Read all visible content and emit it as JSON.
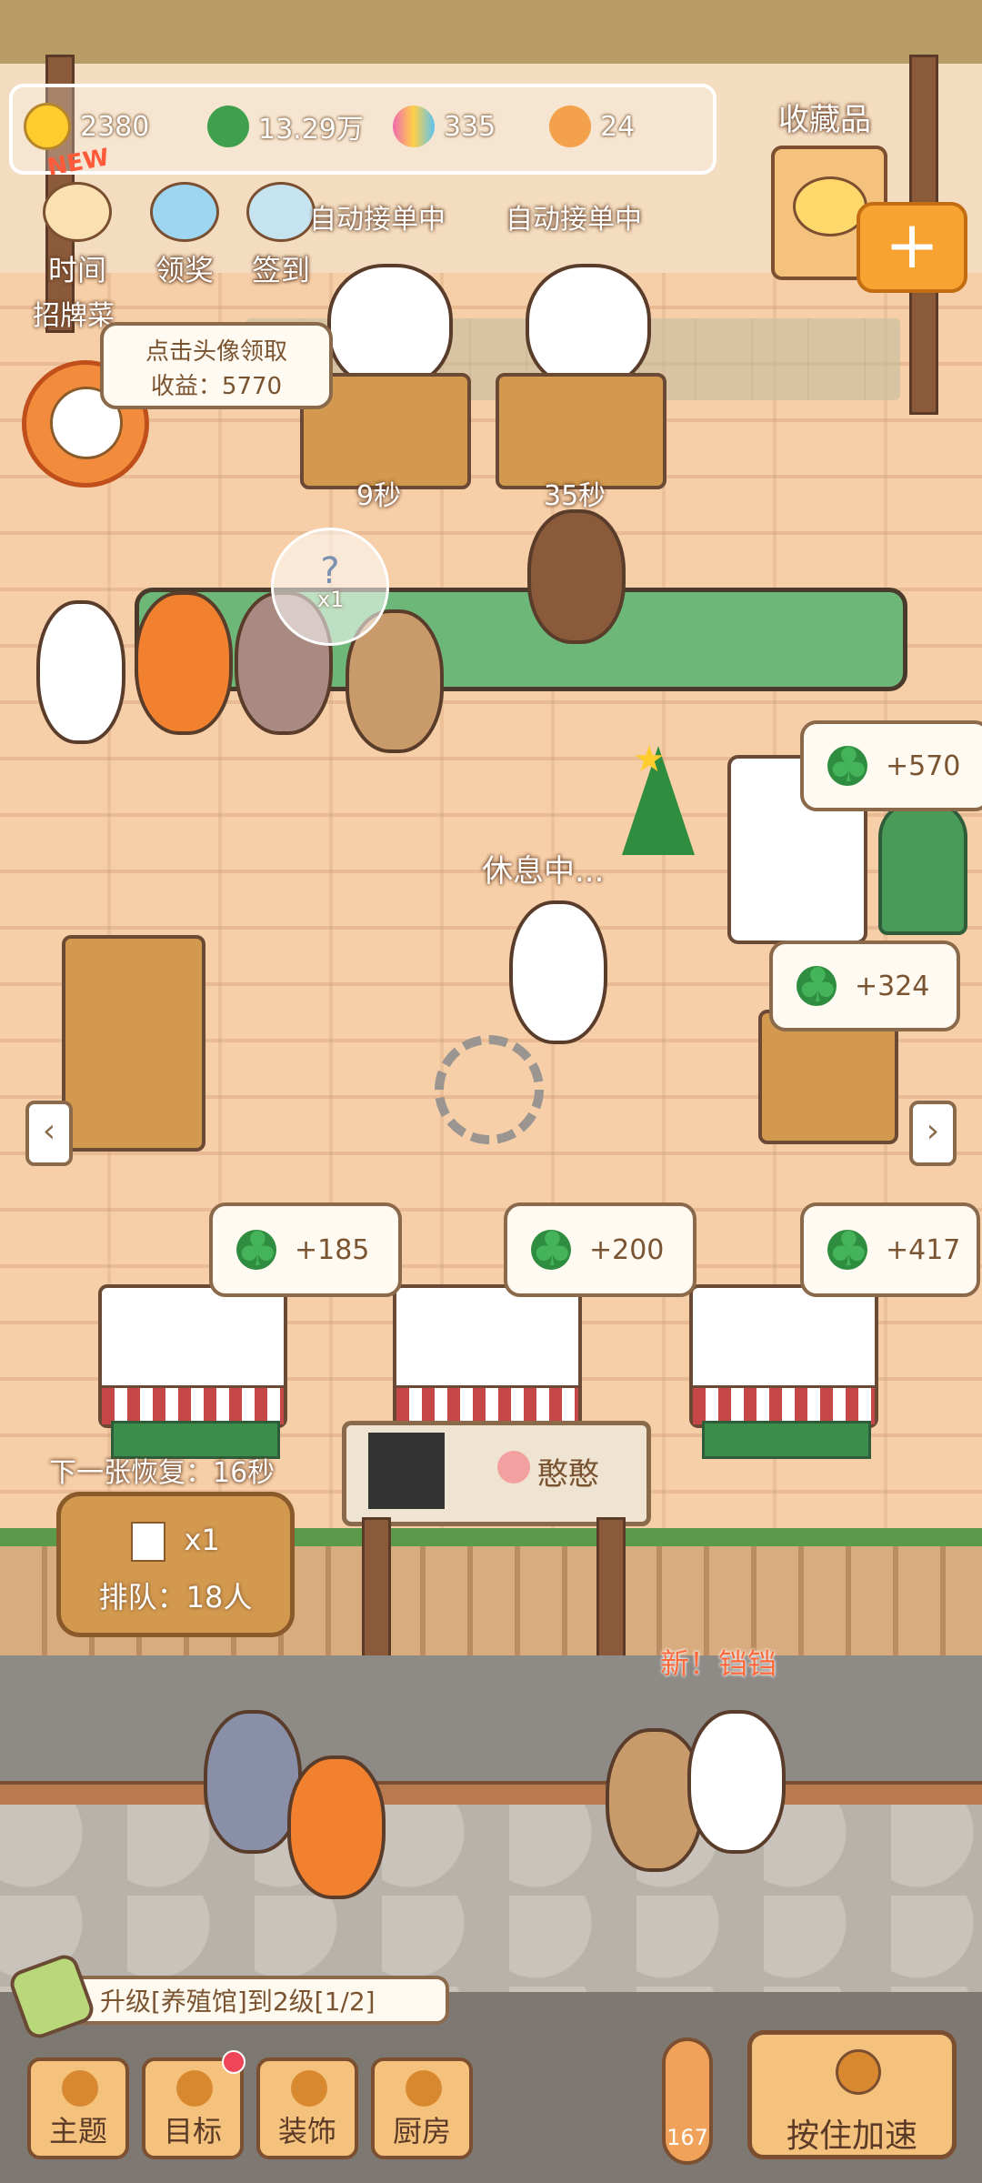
{
  "resources": [
    {
      "icon": "star-icon",
      "value": "2380",
      "color": "#ffcc2e"
    },
    {
      "icon": "clover-icon",
      "value": "13.29万",
      "color": "#3ea04c"
    },
    {
      "icon": "candy-icon",
      "value": "335",
      "color": "#f06bb0"
    },
    {
      "icon": "paw-icon",
      "value": "24",
      "color": "#f3a14a"
    }
  ],
  "collection": {
    "label": "收藏品",
    "add": "+"
  },
  "top_menu": [
    {
      "label": "时间",
      "badge": "NEW"
    },
    {
      "label": "领奖"
    },
    {
      "label": "签到"
    }
  ],
  "signature_dish": {
    "label": "招牌菜",
    "hint": "点击头像领取",
    "income": "收益：5770"
  },
  "chefs": [
    {
      "status": "自动接单中",
      "timer": "9秒"
    },
    {
      "status": "自动接单中",
      "timer": "35秒"
    }
  ],
  "mystery_bubble": {
    "text": "?",
    "count": "x1"
  },
  "waiter_status": "休息中...",
  "rewards": {
    "machine_top": "+570",
    "machine_mid": "+324",
    "table_1": "+185",
    "table_2": "+200",
    "table_3": "+417"
  },
  "queue": {
    "recover": "下一张恢复：16秒",
    "tickets": "x1",
    "line": "排队：18人"
  },
  "gate_sign": "憨憨",
  "new_guest": "新！铛铛",
  "task": {
    "text": "升级[养殖馆]到2级[1/2]"
  },
  "bottom_nav": [
    {
      "label": "主题"
    },
    {
      "label": "目标",
      "dot": true
    },
    {
      "label": "装饰"
    },
    {
      "label": "厨房"
    }
  ],
  "energy": "167",
  "speed_button": "按住加速",
  "nav_arrows": {
    "left": "‹",
    "right": "›"
  }
}
